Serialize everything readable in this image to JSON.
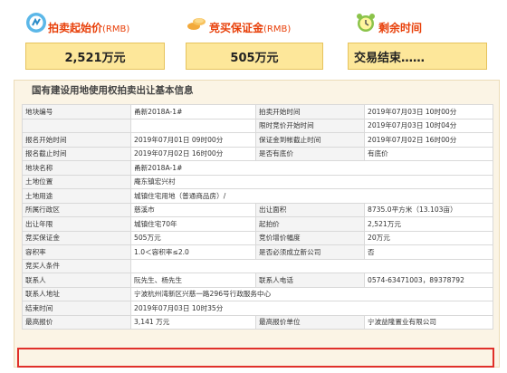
{
  "panels": {
    "start_price": {
      "label": "拍卖起始价",
      "unit": "(RMB)",
      "value": "2,521万元",
      "icon": "money-bag-icon"
    },
    "deposit": {
      "label": "竞买保证金",
      "unit": "(RMB)",
      "value": "505万元",
      "icon": "coins-icon"
    },
    "time_left": {
      "label": "剩余时间",
      "value": "交易结束……",
      "icon": "alarm-clock-icon"
    }
  },
  "info": {
    "title": "国有建设用地使用权拍卖出让基本信息",
    "rows": [
      {
        "l1": "地块编号",
        "v1": "甬新2018A-1#",
        "l2": "拍卖开始时间",
        "v2": "2019年07月03日 10时00分"
      },
      {
        "l1": "",
        "v1": "",
        "l2": "限时竞价开始时间",
        "v2": "2019年07月03日 10时04分"
      },
      {
        "l1": "报名开始时间",
        "v1": "2019年07月01日 09时00分",
        "l2": "保证金到帐截止时间",
        "v2": "2019年07月02日 16时00分"
      },
      {
        "l1": "报名截止时间",
        "v1": "2019年07月02日 16时00分",
        "l2": "是否有底价",
        "v2": "有底价"
      },
      {
        "l1": "地块名称",
        "v1": "甬新2018A-1#"
      },
      {
        "l1": "土地位置",
        "v1": "庵东镇宏兴村"
      },
      {
        "l1": "土地用途",
        "v1": "城镇住宅用地（普通商品房）/"
      },
      {
        "l1": "所属行政区",
        "v1": "慈溪市",
        "l2": "出让面积",
        "v2": "8735.0平方米（13.103亩）"
      },
      {
        "l1": "出让年限",
        "v1": "城镇住宅70年",
        "l2": "起拍价",
        "v2": "2,521万元"
      },
      {
        "l1": "竞买保证金",
        "v1": "505万元",
        "l2": "竞价增价幅度",
        "v2": "20万元"
      },
      {
        "l1": "容积率",
        "v1": "1.0＜容积率≤2.0",
        "l2": "是否必须成立新公司",
        "v2": "否"
      },
      {
        "l1": "竞买人条件",
        "v1": ""
      },
      {
        "l1": "联系人",
        "v1": "阮先生、杨先生",
        "l2": "联系人电话",
        "v2": "0574-63471003，89378792"
      },
      {
        "l1": "联系人地址",
        "v1": "宁波杭州湾新区兴慈一路296号行政服务中心"
      },
      {
        "l1": "结束时间",
        "v1": "2019年07月03日 10时35分"
      },
      {
        "l1": "最高报价",
        "v1": "3,141 万元",
        "l2": "最高报价单位",
        "v2": "宁波益隆置业有限公司"
      }
    ]
  },
  "colors": {
    "accent": "#e8400a",
    "panel_bg": "#fde79a",
    "highlight": "#e0302a"
  }
}
